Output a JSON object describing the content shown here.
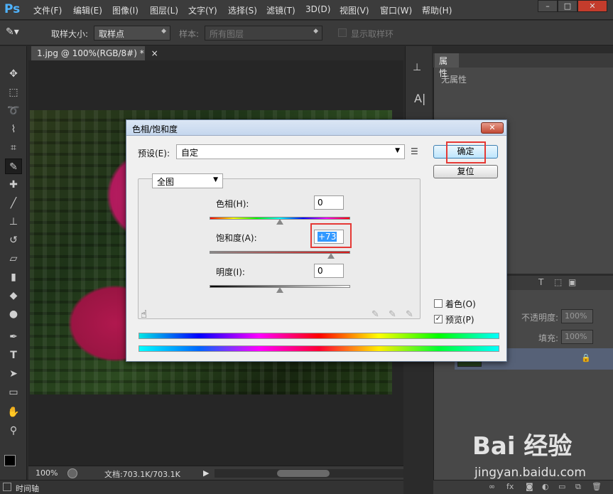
{
  "app": {
    "logo": "Ps"
  },
  "menu": [
    "文件(F)",
    "编辑(E)",
    "图像(I)",
    "图层(L)",
    "文字(Y)",
    "选择(S)",
    "滤镜(T)",
    "3D(D)",
    "视图(V)",
    "窗口(W)",
    "帮助(H)"
  ],
  "window_controls": {
    "minimize": "–",
    "maximize": "□",
    "close": "✕"
  },
  "options_bar": {
    "sample_size_label": "取样大小:",
    "sample_size_value": "取样点",
    "sample_label": "样本:",
    "sample_value": "所有图层",
    "show_ring_label": "显示取样环"
  },
  "document": {
    "tab_title": "1.jpg @ 100%(RGB/8#) *",
    "tab_close": "×"
  },
  "status": {
    "zoom": "100%",
    "doc_info": "文档:703.1K/703.1K",
    "timeline": "时间轴"
  },
  "properties_panel": {
    "tab": "属性",
    "content": "无属性"
  },
  "layers_panel": {
    "opacity_label": "不透明度:",
    "opacity_value": "100%",
    "fill_label": "填充:",
    "fill_value": "100%"
  },
  "dialog": {
    "title": "色相/饱和度",
    "close": "✕",
    "preset_label": "预设(E):",
    "preset_value": "自定",
    "ok_label": "确定",
    "reset_label": "复位",
    "channel_value": "全图",
    "hue_label": "色相(H):",
    "hue_value": "0",
    "saturation_label": "饱和度(A):",
    "saturation_value": "+73",
    "lightness_label": "明度(I):",
    "lightness_value": "0",
    "colorize_label": "着色(O)",
    "colorize_checked": false,
    "preview_label": "预览(P)",
    "preview_checked": true,
    "slider_levels": {
      "hue": 0.5,
      "saturation": 0.865,
      "lightness": 0.5
    }
  },
  "watermark": {
    "logo": "Bai 经验",
    "url": "jingyan.baidu.com"
  },
  "colors": {
    "accent_highlight": "#e53935",
    "selection": "#3399ff",
    "layer_selected": "#566177"
  }
}
